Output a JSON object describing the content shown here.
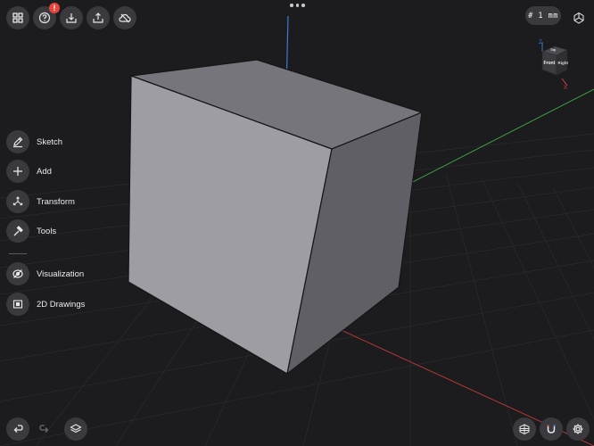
{
  "toolbar": {
    "grid_label": "# 1 mm",
    "help_badge": "!"
  },
  "sidebar": {
    "items": [
      {
        "label": "Sketch",
        "icon": "pencil-icon"
      },
      {
        "label": "Add",
        "icon": "plus-icon"
      },
      {
        "label": "Transform",
        "icon": "transform-arrows-icon"
      },
      {
        "label": "Tools",
        "icon": "hammer-icon"
      },
      {
        "label": "Visualization",
        "icon": "visualization-icon"
      },
      {
        "label": "2D Drawings",
        "icon": "drawing-sheet-icon"
      }
    ]
  },
  "view_cube": {
    "front_label": "Front",
    "right_label": "Right",
    "top_label": "Top",
    "axis_z": "Z",
    "axis_x": "X"
  },
  "colors": {
    "background": "#1c1c1e",
    "button": "#3a3a3e",
    "badge": "#e5453b",
    "axis_x": "#d04040",
    "axis_y": "#3fae4a",
    "axis_z": "#3a7bd5",
    "cube_front": "#9d9da3",
    "cube_top": "#75757b",
    "cube_side": "#5f5f65"
  }
}
